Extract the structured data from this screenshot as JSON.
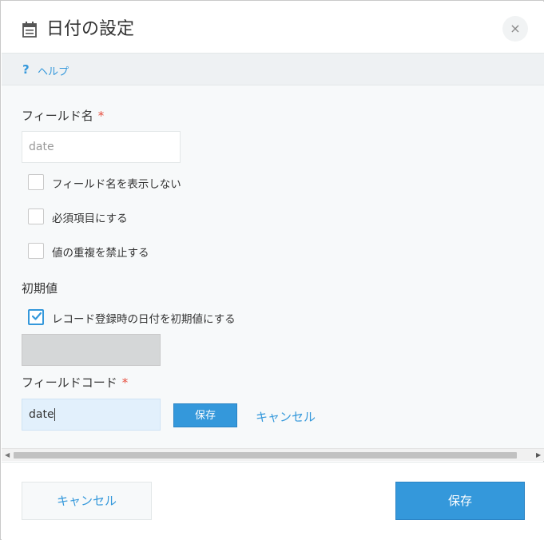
{
  "dialog": {
    "title": "日付の設定",
    "close_label": "×"
  },
  "help": {
    "icon": "?",
    "link": "ヘルプ"
  },
  "field_name": {
    "label": "フィールド名",
    "required_mark": "*",
    "value": "date"
  },
  "options": [
    {
      "label": "フィールド名を表示しない",
      "checked": false
    },
    {
      "label": "必須項目にする",
      "checked": false
    },
    {
      "label": "値の重複を禁止する",
      "checked": false
    }
  ],
  "initial_value": {
    "label": "初期値",
    "checkbox_label": "レコード登録時の日付を初期値にする",
    "checked": true
  },
  "field_code": {
    "label": "フィールドコード",
    "required_mark": "*",
    "value": "date",
    "save_label": "保存",
    "cancel_label": "キャンセル"
  },
  "footer": {
    "cancel_label": "キャンセル",
    "save_label": "保存"
  },
  "colors": {
    "accent": "#3498db",
    "required": "#e74c3c"
  }
}
